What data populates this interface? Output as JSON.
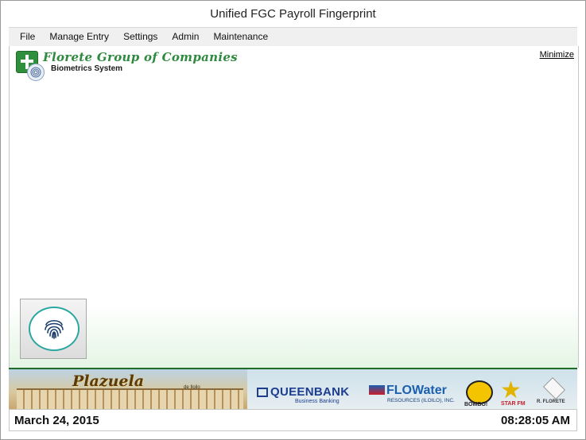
{
  "window": {
    "title": "Unified FGC Payroll Fingerprint"
  },
  "menu": {
    "items": [
      "File",
      "Manage Entry",
      "Settings",
      "Admin",
      "Maintenance"
    ]
  },
  "header": {
    "company_name": "Florete Group of Companies",
    "subtitle": "Biometrics System",
    "minimize_label": "Minimize"
  },
  "fingerprint_button": {
    "icon": "fingerprint-icon",
    "accent_color": "#2aa7a0"
  },
  "banner": {
    "plazuela_name": "Plazuela",
    "plazuela_sub": "de Iloilo",
    "queenbank_name": "QUEENBANK",
    "queenbank_sub": "Business Banking",
    "flowater_name": "FLOWater",
    "flowater_sub": "RESOURCES (ILOILO), INC.",
    "bombo_label": "BOMBO!",
    "starfm_label": "STAR FM",
    "rflorete_label": "R. FLORETE",
    "divider_color": "#1e6b2a"
  },
  "status": {
    "date": "March 24, 2015",
    "time": "08:28:05 AM"
  },
  "colors": {
    "brand_green": "#2d8a3e",
    "bank_blue": "#1d3d8f"
  }
}
